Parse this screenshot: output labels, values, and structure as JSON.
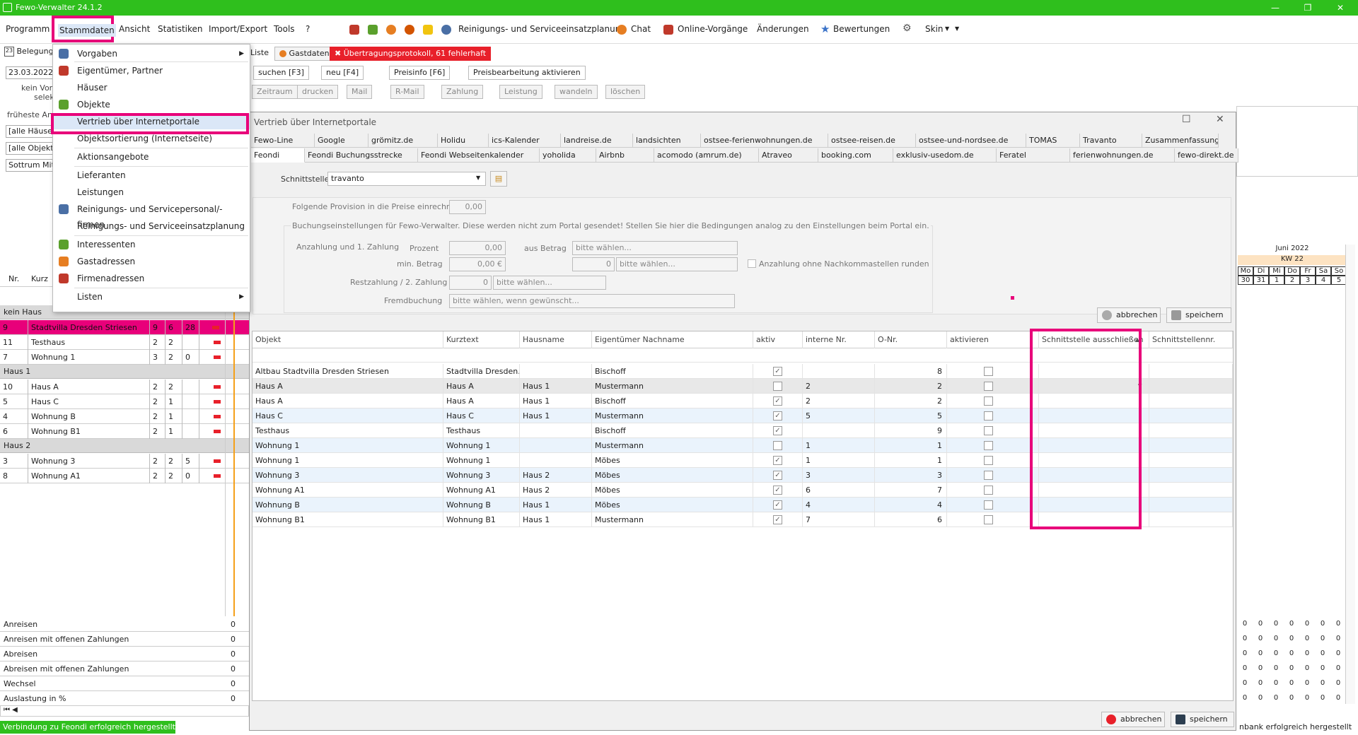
{
  "window": {
    "title": "Fewo-Verwalter 24.1.2"
  },
  "menu": {
    "items": [
      "Programm",
      "Stammdaten",
      "Ansicht",
      "Statistiken",
      "Import/Export",
      "Tools",
      "?"
    ],
    "ribbon": {
      "cleaning": "Reinigungs- und Serviceeinsatzplanung",
      "chat": "Chat",
      "online": "Online-Vorgänge",
      "changes": "Änderungen",
      "ratings": "Bewertungen",
      "skin": "Skin"
    }
  },
  "dropdown": {
    "items": [
      {
        "label": "Vorgaben",
        "sub": true
      },
      {
        "label": "Eigentümer, Partner"
      },
      {
        "label": "Häuser"
      },
      {
        "label": "Objekte"
      },
      {
        "label": "Vertrieb über Internetportale"
      },
      {
        "label": "Objektsortierung (Internetseite)"
      },
      {
        "label": "Aktionsangebote"
      },
      {
        "label": "Lieferanten"
      },
      {
        "label": "Leistungen"
      },
      {
        "label": "Reinigungs- und Servicepersonal/-firmen"
      },
      {
        "label": "Reinigungs- und Serviceeinsatzplanung"
      },
      {
        "label": "Interessenten"
      },
      {
        "label": "Gastadressen"
      },
      {
        "label": "Firmenadressen"
      },
      {
        "label": "Listen",
        "sub": true
      }
    ]
  },
  "left": {
    "belegung": "Belegung",
    "date": "23.03.2022",
    "note1": "kein Vorg",
    "note2": "selek",
    "earliest": "früheste Anr",
    "filter1": "[alle Häuser]",
    "filter2": "[alle Objekte]",
    "filter3": "Sottrum Mitte",
    "col_nr": "Nr.",
    "col_kurz": "Kurz",
    "groups": [
      {
        "name": "kein Haus",
        "rows": [
          {
            "nr": "9",
            "name": "Stadtvilla Dresden Striesen",
            "a": "9",
            "b": "6",
            "c": "28",
            "sel": true
          },
          {
            "nr": "11",
            "name": "Testhaus",
            "a": "2",
            "b": "2",
            "c": ""
          },
          {
            "nr": "7",
            "name": "Wohnung 1",
            "a": "3",
            "b": "2",
            "c": "0"
          }
        ]
      },
      {
        "name": "Haus 1",
        "rows": [
          {
            "nr": "10",
            "name": "Haus A",
            "a": "2",
            "b": "2",
            "c": ""
          },
          {
            "nr": "5",
            "name": "Haus C",
            "a": "2",
            "b": "1",
            "c": ""
          },
          {
            "nr": "4",
            "name": "Wohnung B",
            "a": "2",
            "b": "1",
            "c": ""
          },
          {
            "nr": "6",
            "name": "Wohnung B1",
            "a": "2",
            "b": "1",
            "c": ""
          }
        ]
      },
      {
        "name": "Haus 2",
        "rows": [
          {
            "nr": "3",
            "name": "Wohnung 3",
            "a": "2",
            "b": "2",
            "c": "5"
          },
          {
            "nr": "8",
            "name": "Wohnung A1",
            "a": "2",
            "b": "2",
            "c": "0"
          }
        ]
      }
    ],
    "summary": [
      {
        "label": "Anreisen",
        "v": "0"
      },
      {
        "label": "Anreisen mit offenen Zahlungen",
        "v": "0"
      },
      {
        "label": "Abreisen",
        "v": "0"
      },
      {
        "label": "Abreisen mit offenen Zahlungen",
        "v": "0"
      },
      {
        "label": "Wechsel",
        "v": "0"
      },
      {
        "label": "Auslastung in %",
        "v": "0"
      }
    ]
  },
  "tabs_top": {
    "liste": "Liste",
    "gastdaten": "Gastdaten",
    "protokoll": "Übertragungsprotokoll, 61 fehlerhaft"
  },
  "toolbar1": {
    "suchen": "suchen [F3]",
    "neu": "neu [F4]",
    "preisinfo": "Preisinfo [F6]",
    "preisbearbeitung": "Preisbearbeitung aktivieren"
  },
  "toolbar2": {
    "zeitraum": "Zeitraum",
    "drucken": "drucken",
    "mail": "Mail",
    "rmail": "R-Mail",
    "zahlung": "Zahlung",
    "leistung": "Leistung",
    "wandeln": "wandeln",
    "loeschen": "löschen"
  },
  "dialog": {
    "title": "Vertrieb über Internetportale",
    "tabs_row1": [
      "Fewo-Line",
      "Google",
      "grömitz.de",
      "Holidu",
      "ics-Kalender",
      "landreise.de",
      "landsichten",
      "ostsee-ferienwohnungen.de",
      "ostsee-reisen.de",
      "ostsee-und-nordsee.de",
      "TOMAS",
      "Travanto",
      "Zusammenfassung"
    ],
    "tabs_row2": [
      "Feondi",
      "Feondi Buchungsstrecke",
      "Feondi Webseitenkalender",
      "yoholida",
      "Airbnb",
      "acomodo (amrum.de)",
      "Atraveo",
      "booking.com",
      "exklusiv-usedom.de",
      "Feratel",
      "ferienwohnungen.de",
      "fewo-direkt.de"
    ],
    "schnittstelle_label": "Schnittstelle",
    "schnittstelle_value": "travanto",
    "provision_label": "Folgende Provision in die Preise einrechnen",
    "provision_value": "0,00",
    "booking_group": "Buchungseinstellungen für Fewo-Verwalter. Diese werden nicht zum Portal gesendet! Stellen Sie hier die Bedingungen analog zu den Einstellungen beim Portal ein.",
    "anzahlung_label": "Anzahlung und 1. Zahlung",
    "prozent_label": "Prozent",
    "prozent_value": "0,00",
    "aus_betrag_label": "aus Betrag",
    "bitte_waehlen": "bitte wählen...",
    "min_betrag_label": "min. Betrag",
    "min_betrag_value": "0,00 €",
    "zero": "0",
    "anzahlung_runden": "Anzahlung ohne Nachkommastellen runden",
    "restzahlung_label": "Restzahlung / 2. Zahlung",
    "fremdbuchung_label": "Fremdbuchung",
    "fremdbuchung_value": "bitte wählen, wenn gewünscht...",
    "abbrechen": "abbrechen",
    "speichern": "speichern",
    "footer_value": "0"
  },
  "grid": {
    "headers": [
      "Objekt",
      "Kurztext",
      "Hausname",
      "Eigentümer Nachname",
      "aktiv",
      "interne Nr.",
      "O-Nr.",
      "aktivieren",
      "Schnittstelle ausschließen",
      "Schnittstellennr."
    ],
    "rows": [
      {
        "objekt": "Altbau Stadtvilla Dresden Striesen",
        "kurz": "Stadtvilla Dresden...",
        "haus": "",
        "eig": "Bischoff",
        "aktiv": true,
        "inr": "",
        "onr": "8"
      },
      {
        "objekt": "Haus A",
        "kurz": "Haus A",
        "haus": "Haus 1",
        "eig": "Mustermann",
        "aktiv": false,
        "inr": "2",
        "onr": "2",
        "focus": true
      },
      {
        "objekt": "Haus A",
        "kurz": "Haus A",
        "haus": "Haus 1",
        "eig": "Bischoff",
        "aktiv": true,
        "inr": "2",
        "onr": "2"
      },
      {
        "objekt": "Haus C",
        "kurz": "Haus C",
        "haus": "Haus 1",
        "eig": "Mustermann",
        "aktiv": true,
        "inr": "5",
        "onr": "5"
      },
      {
        "objekt": "Testhaus",
        "kurz": "Testhaus",
        "haus": "",
        "eig": "Bischoff",
        "aktiv": true,
        "inr": "",
        "onr": "9"
      },
      {
        "objekt": "Wohnung 1",
        "kurz": "Wohnung 1",
        "haus": "",
        "eig": "Mustermann",
        "aktiv": false,
        "inr": "1",
        "onr": "1"
      },
      {
        "objekt": "Wohnung 1",
        "kurz": "Wohnung 1",
        "haus": "",
        "eig": "Möbes",
        "aktiv": true,
        "inr": "1",
        "onr": "1"
      },
      {
        "objekt": "Wohnung 3",
        "kurz": "Wohnung 3",
        "haus": "Haus 2",
        "eig": "Möbes",
        "aktiv": true,
        "inr": "3",
        "onr": "3"
      },
      {
        "objekt": "Wohnung A1",
        "kurz": "Wohnung A1",
        "haus": "Haus 2",
        "eig": "Möbes",
        "aktiv": true,
        "inr": "6",
        "onr": "7"
      },
      {
        "objekt": "Wohnung B",
        "kurz": "Wohnung B",
        "haus": "Haus 1",
        "eig": "Möbes",
        "aktiv": true,
        "inr": "4",
        "onr": "4"
      },
      {
        "objekt": "Wohnung B1",
        "kurz": "Wohnung B1",
        "haus": "Haus 1",
        "eig": "Mustermann",
        "aktiv": true,
        "inr": "7",
        "onr": "6"
      }
    ]
  },
  "calendar": {
    "month": "Juni 2022",
    "week": "KW 22",
    "days": [
      "Mo",
      "Di",
      "Mi",
      "Do",
      "Fr",
      "Sa",
      "So"
    ],
    "dates": [
      "30",
      "31",
      "1",
      "2",
      "3",
      "4",
      "5"
    ]
  },
  "status": {
    "left": "Verbindung zu Feondi erfolgreich hergestellt",
    "right": "nbank erfolgreich hergestellt"
  },
  "colors": {
    "accent": "#e8007a",
    "titlebar": "#2fbf1d"
  }
}
